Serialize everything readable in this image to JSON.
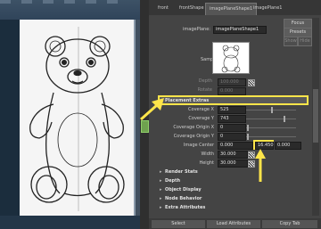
{
  "tabs": [
    {
      "label": "front"
    },
    {
      "label": "frontShape"
    },
    {
      "label": "imagePlaneShape1"
    },
    {
      "label": "imagePlane1"
    }
  ],
  "header": {
    "node_type_label": "imagePlane:",
    "node_name_value": "imagePlaneShape1",
    "focus_label": "Focus",
    "presets_label": "Presets",
    "show_label": "Show",
    "hide_label": "Hide"
  },
  "sample": {
    "label": "Sample"
  },
  "partial_rows": [
    {
      "label": "Depth",
      "value": "100.000"
    },
    {
      "label": "Rotate",
      "value": "0.000"
    }
  ],
  "placement_section": {
    "title": "Placement Extras"
  },
  "coverage": [
    {
      "label": "Coverage X",
      "value": "525"
    },
    {
      "label": "Coverage Y",
      "value": "743"
    },
    {
      "label": "Coverage Origin X",
      "value": "0"
    },
    {
      "label": "Coverage Origin Y",
      "value": "0"
    }
  ],
  "image_center": {
    "label": "Image Center",
    "x": "0.000",
    "y": "16.450",
    "z": "0.000"
  },
  "width": {
    "label": "Width",
    "value": "30.000"
  },
  "height": {
    "label": "Height",
    "value": "30.000"
  },
  "sections": [
    {
      "title": "Render Stats"
    },
    {
      "title": "Depth"
    },
    {
      "title": "Object Display"
    },
    {
      "title": "Node Behavior"
    },
    {
      "title": "Extra Attributes"
    }
  ],
  "bottom_bar": {
    "select": "Select",
    "load": "Load Attributes",
    "copy": "Copy Tab"
  },
  "colors": {
    "highlight": "#ffe54a",
    "accent_green": "#6fa24f",
    "viewport_bg": "#1b2d3d"
  }
}
